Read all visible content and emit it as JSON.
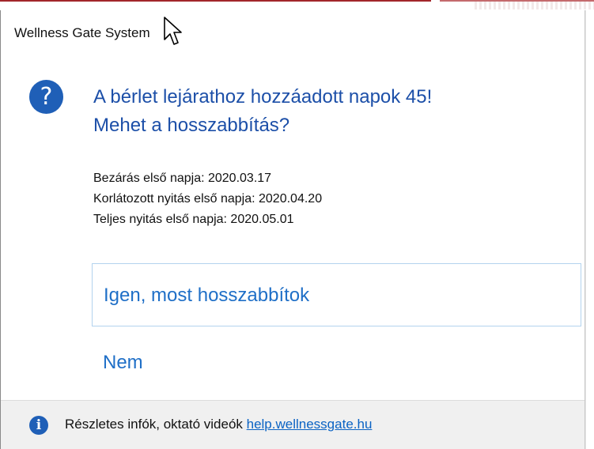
{
  "window": {
    "title": "Wellness Gate System"
  },
  "dialog": {
    "icon": "question-icon",
    "main_instruction_line1": "A bérlet lejárathoz hozzáadott napok 45!",
    "main_instruction_line2": "Mehet a hosszabbítás?",
    "content_lines": [
      "Bezárás első napja: 2020.03.17",
      "Korlátozott nyitás első napja: 2020.04.20",
      "Teljes nyitás első napja: 2020.05.01"
    ],
    "commands": {
      "yes_label": "Igen, most hosszabbítok",
      "no_label": "Nem"
    },
    "footer": {
      "icon": "info-icon",
      "text": "Részletes infók, oktató videók ",
      "link_text": "help.wellnessgate.hu"
    }
  },
  "colors": {
    "instruction_blue": "#1c4fa8",
    "command_link_blue": "#1f6fc7",
    "icon_blue": "#1f5fb7",
    "footer_bg": "#f0f0f0",
    "accent_border": "#a2262a"
  }
}
